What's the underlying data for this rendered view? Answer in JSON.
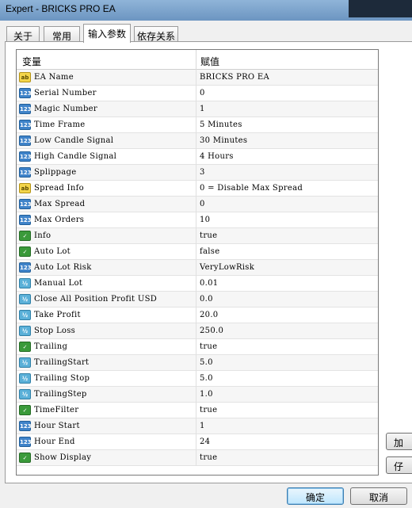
{
  "window": {
    "title": "Expert - BRICKS PRO EA"
  },
  "tabs": [
    {
      "label": "关于"
    },
    {
      "label": "常用"
    },
    {
      "label": "输入参数"
    },
    {
      "label": "依存关系"
    }
  ],
  "grid": {
    "col_variable": "变量",
    "col_value": "赋值",
    "rows": [
      {
        "icon": "txt",
        "icon_label": "ab",
        "name": "EA Name",
        "value": "BRICKS PRO EA"
      },
      {
        "icon": "num",
        "icon_label": "123",
        "name": "Serial Number",
        "value": "0"
      },
      {
        "icon": "num",
        "icon_label": "123",
        "name": "Magic Number",
        "value": "1"
      },
      {
        "icon": "num",
        "icon_label": "123",
        "name": "Time Frame",
        "value": "5 Minutes"
      },
      {
        "icon": "num",
        "icon_label": "123",
        "name": "Low Candle Signal",
        "value": "30 Minutes"
      },
      {
        "icon": "num",
        "icon_label": "123",
        "name": "High Candle Signal",
        "value": "4 Hours"
      },
      {
        "icon": "num",
        "icon_label": "123",
        "name": "Splippage",
        "value": "3"
      },
      {
        "icon": "txt",
        "icon_label": "ab",
        "name": "Spread Info",
        "value": "0 = Disable Max Spread"
      },
      {
        "icon": "num",
        "icon_label": "123",
        "name": "Max Spread",
        "value": "0"
      },
      {
        "icon": "num",
        "icon_label": "123",
        "name": "Max Orders",
        "value": "10"
      },
      {
        "icon": "bool",
        "icon_label": "✓",
        "name": "Info",
        "value": "true"
      },
      {
        "icon": "bool",
        "icon_label": "✓",
        "name": "Auto Lot",
        "value": "false"
      },
      {
        "icon": "num",
        "icon_label": "123",
        "name": "Auto Lot Risk",
        "value": "VeryLowRisk"
      },
      {
        "icon": "dbl",
        "icon_label": "½",
        "name": "Manual Lot",
        "value": "0.01"
      },
      {
        "icon": "dbl",
        "icon_label": "½",
        "name": "Close All Position Profit USD",
        "value": "0.0"
      },
      {
        "icon": "dbl",
        "icon_label": "½",
        "name": "Take Profit",
        "value": "20.0"
      },
      {
        "icon": "dbl",
        "icon_label": "½",
        "name": "Stop Loss",
        "value": "250.0"
      },
      {
        "icon": "bool",
        "icon_label": "✓",
        "name": "Trailing",
        "value": "true"
      },
      {
        "icon": "dbl",
        "icon_label": "½",
        "name": "TrailingStart",
        "value": "5.0"
      },
      {
        "icon": "dbl",
        "icon_label": "½",
        "name": "Trailing Stop",
        "value": "5.0"
      },
      {
        "icon": "dbl",
        "icon_label": "½",
        "name": "TrailingStep",
        "value": "1.0"
      },
      {
        "icon": "bool",
        "icon_label": "✓",
        "name": "TimeFilter",
        "value": "true"
      },
      {
        "icon": "num",
        "icon_label": "123",
        "name": "Hour Start",
        "value": "1"
      },
      {
        "icon": "num",
        "icon_label": "123",
        "name": "Hour End",
        "value": "24"
      },
      {
        "icon": "bool",
        "icon_label": "✓",
        "name": "Show Display",
        "value": "true"
      }
    ]
  },
  "side_buttons": {
    "load": "加",
    "save": "仔"
  },
  "buttons": {
    "ok": "确定",
    "cancel": "取消"
  }
}
